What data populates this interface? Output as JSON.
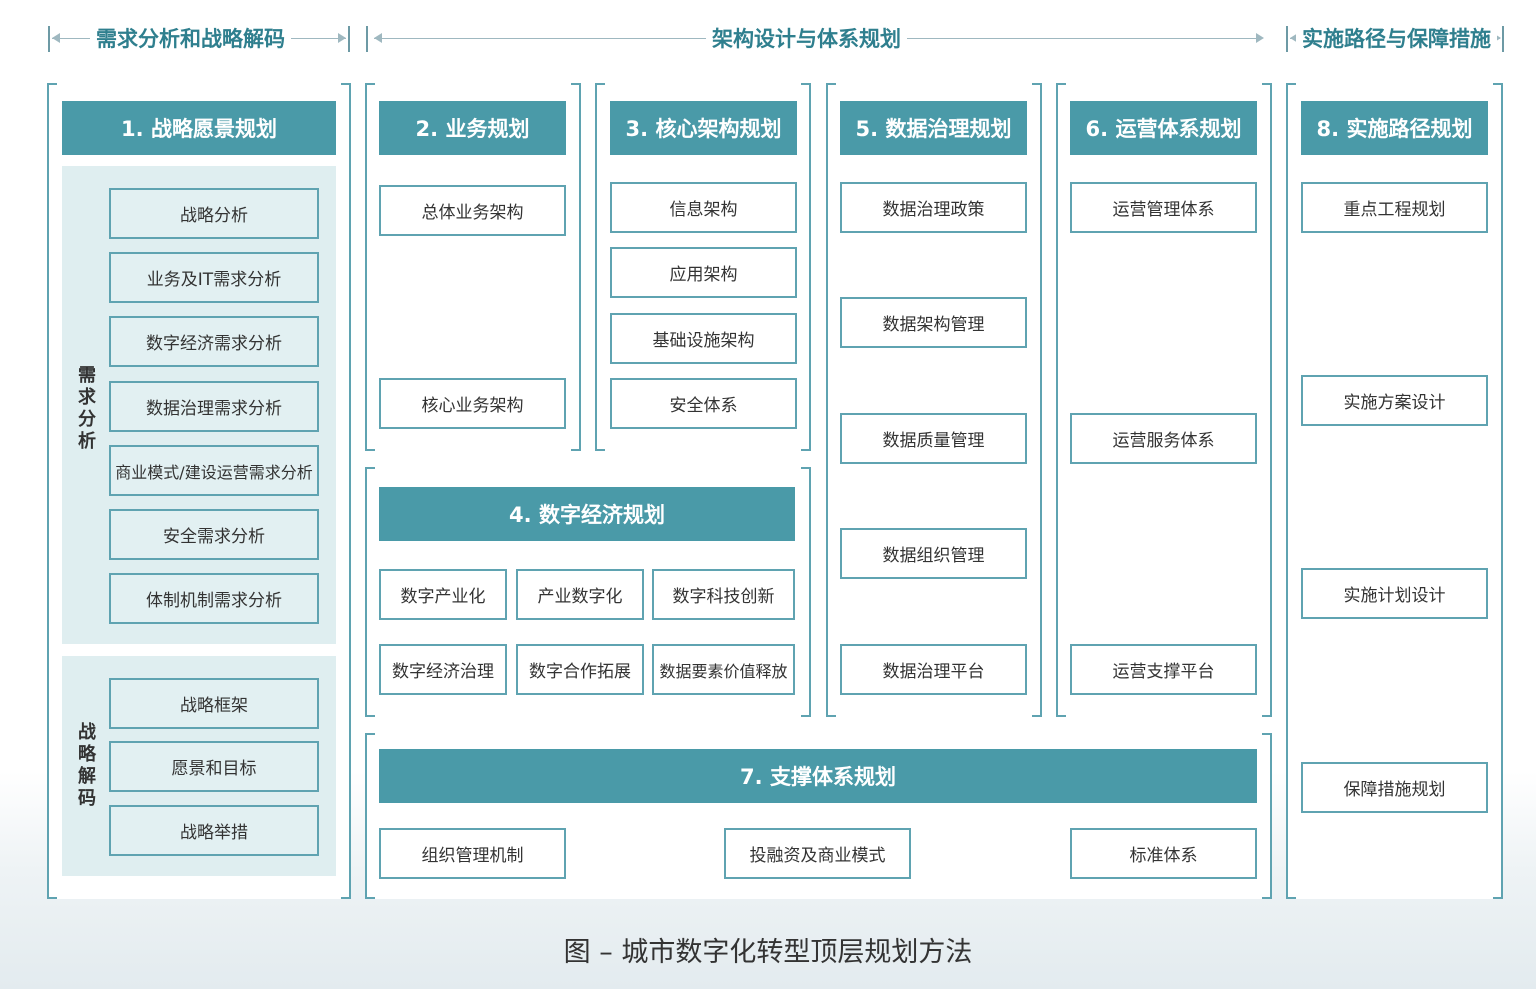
{
  "headers": {
    "left": "需求分析和战略解码",
    "middle": "架构设计与体系规划",
    "right": "实施路径与保障措施"
  },
  "s1": {
    "title": "1. 战略愿景规划",
    "group_a_label": "需求分析",
    "group_a_items": [
      "战略分析",
      "业务及IT需求分析",
      "数字经济需求分析",
      "数据治理需求分析",
      "商业模式/建设运营需求分析",
      "安全需求分析",
      "体制机制需求分析"
    ],
    "group_b_label": "战略解码",
    "group_b_items": [
      "战略框架",
      "愿景和目标",
      "战略举措"
    ]
  },
  "s2": {
    "title": "2. 业务规划",
    "items": [
      "总体业务架构",
      "核心业务架构"
    ]
  },
  "s3": {
    "title": "3. 核心架构规划",
    "items": [
      "信息架构",
      "应用架构",
      "基础设施架构",
      "安全体系"
    ]
  },
  "s4": {
    "title": "4. 数字经济规划",
    "items": [
      "数字产业化",
      "产业数字化",
      "数字科技创新",
      "数字经济治理",
      "数字合作拓展",
      "数据要素价值释放"
    ]
  },
  "s5": {
    "title": "5. 数据治理规划",
    "items": [
      "数据治理政策",
      "数据架构管理",
      "数据质量管理",
      "数据组织管理",
      "数据治理平台"
    ]
  },
  "s6": {
    "title": "6. 运营体系规划",
    "items": [
      "运营管理体系",
      "运营服务体系",
      "运营支撑平台"
    ]
  },
  "s7": {
    "title": "7. 支撑体系规划",
    "items": [
      "组织管理机制",
      "投融资及商业模式",
      "标准体系"
    ]
  },
  "s8": {
    "title": "8. 实施路径规划",
    "items": [
      "重点工程规划",
      "实施方案设计",
      "实施计划设计",
      "保障措施规划"
    ]
  },
  "caption": "图 – 城市数字化转型顶层规划方法"
}
